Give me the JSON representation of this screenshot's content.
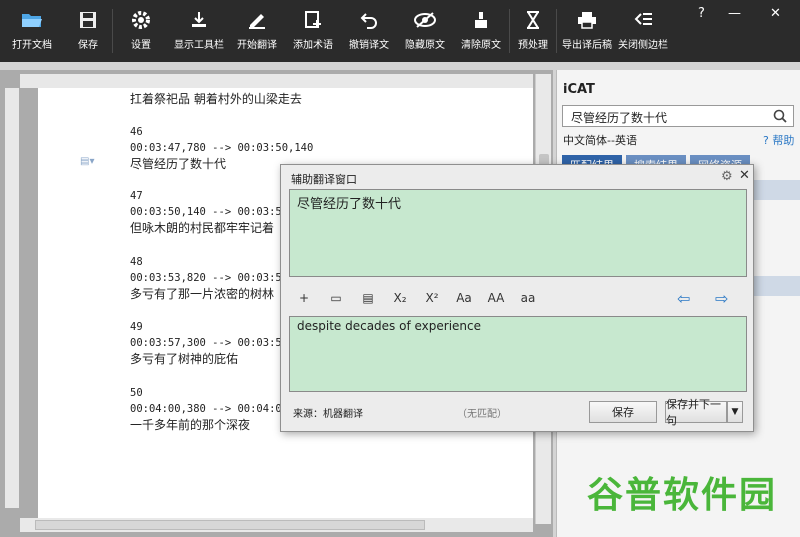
{
  "toolbar": {
    "open": "打开文档",
    "save": "保存",
    "settings": "设置",
    "show_toolbar": "显示工具栏",
    "start_translate": "开始翻译",
    "add_term": "添加术语",
    "undo_translation": "撤销译文",
    "hide_source": "隐藏原文",
    "clear_source": "清除原文",
    "preprocess": "预处理",
    "export": "导出译后稿",
    "close_sidebar": "关闭侧边栏"
  },
  "window": {
    "help": "?",
    "minimize": "—",
    "close": "✕"
  },
  "document": {
    "segments": [
      {
        "num": "",
        "tc": "",
        "text": "扛着祭祀品 朝着村外的山梁走去"
      },
      {
        "num": "46",
        "tc": "00:03:47,780 --> 00:03:50,140",
        "text": "尽管经历了数十代"
      },
      {
        "num": "47",
        "tc": "00:03:50,140 --> 00:03:53,820",
        "text": "但咏木朗的村民都牢牢记着"
      },
      {
        "num": "48",
        "tc": "00:03:53,820 --> 00:03:57,300",
        "text": "多亏有了那一片浓密的树林"
      },
      {
        "num": "49",
        "tc": "00:03:57,300 --> 00:03:59,620",
        "text": "多亏有了树神的庇佑"
      },
      {
        "num": "50",
        "tc": "00:04:00,380 --> 00:04:02,540",
        "text": "一千多年前的那个深夜"
      }
    ]
  },
  "panel": {
    "title": "iCAT",
    "search_value": "尽管经历了数十代",
    "lang": "中文简体--英语",
    "help": "帮助",
    "tabs": [
      "匹配结果",
      "搜索结果",
      "网络资源"
    ],
    "logo_text": "谷普软件园"
  },
  "dialog": {
    "title": "辅助翻译窗口",
    "source": "尽管经历了数十代",
    "target": "despite decades of experience",
    "format_buttons": [
      "+",
      "X₂",
      "X²",
      "Aa",
      "AA",
      "aa"
    ],
    "source_label": "来源：机器翻译",
    "match_label": "（无匹配）",
    "save": "保存",
    "save_next": "保存并下一句"
  },
  "colors": {
    "toolbar_bg": "#2b2b2b",
    "editor_green": "#c7e8cf",
    "accent": "#2b78c5"
  }
}
